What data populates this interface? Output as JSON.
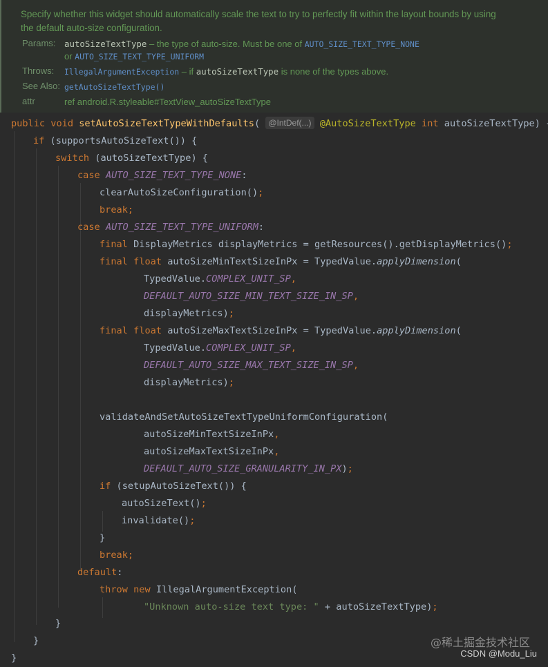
{
  "doc": {
    "description": "Specify whether this widget should automatically scale the text to try to perfectly fit within the layout bounds by using the default auto-size configuration.",
    "params_label": "Params:",
    "params_name": "autoSizeTextType",
    "params_text1": " – the type of auto-size. Must be one of ",
    "params_const1": "AUTO_SIZE_TEXT_TYPE_NONE",
    "params_or": "or ",
    "params_const2": "AUTO_SIZE_TEXT_TYPE_UNIFORM",
    "throws_label": "Throws:",
    "throws_type": "IllegalArgumentException",
    "throws_text1": " – if ",
    "throws_ref": "autoSizeTextType",
    "throws_text2": " is none of the types above.",
    "see_label": "See Also:",
    "see_link": "getAutoSizeTextType()",
    "attr_label": "attr",
    "attr_value": "ref android.R.styleable#TextView_autoSizeTextType"
  },
  "code": {
    "sig_public": "public",
    "sig_void": "void",
    "sig_method": "setAutoSizeTextTypeWithDefaults",
    "sig_hint": "@IntDef(...)",
    "sig_annotation": "@AutoSizeTextType",
    "sig_int": "int",
    "sig_param": "autoSizeTextType",
    "if1_kw": "if",
    "if1_cond": "supportsAutoSizeText",
    "switch_kw": "switch",
    "switch_var": "autoSizeTextType",
    "case_kw": "case",
    "case1": "AUTO_SIZE_TEXT_TYPE_NONE",
    "clear_call": "clearAutoSizeConfiguration",
    "break_kw": "break",
    "case2": "AUTO_SIZE_TEXT_TYPE_UNIFORM",
    "final_kw": "final",
    "float_kw": "float",
    "dm_type": "DisplayMetrics",
    "dm_var": "displayMetrics",
    "get_res": "getResources",
    "get_dm": "getDisplayMetrics",
    "min_var": "autoSizeMinTextSizeInPx",
    "max_var": "autoSizeMaxTextSizeInPx",
    "typed_value": "TypedValue",
    "apply_dim": "applyDimension",
    "unit_sp": "COMPLEX_UNIT_SP",
    "def_min": "DEFAULT_AUTO_SIZE_MIN_TEXT_SIZE_IN_SP",
    "def_max": "DEFAULT_AUTO_SIZE_MAX_TEXT_SIZE_IN_SP",
    "validate_call": "validateAndSetAutoSizeTextTypeUniformConfiguration",
    "def_gran": "DEFAULT_AUTO_SIZE_GRANULARITY_IN_PX",
    "setup_call": "setupAutoSizeText",
    "auto_call": "autoSizeText",
    "invalidate_call": "invalidate",
    "default_kw": "default",
    "throw_kw": "throw",
    "new_kw": "new",
    "exception_type": "IllegalArgumentException",
    "error_msg": "\"Unknown auto-size text type: \"",
    "error_var": "autoSizeTextType"
  },
  "watermark": {
    "site": "@稀土掘金技术社区",
    "author": "CSDN @Modu_Liu"
  }
}
